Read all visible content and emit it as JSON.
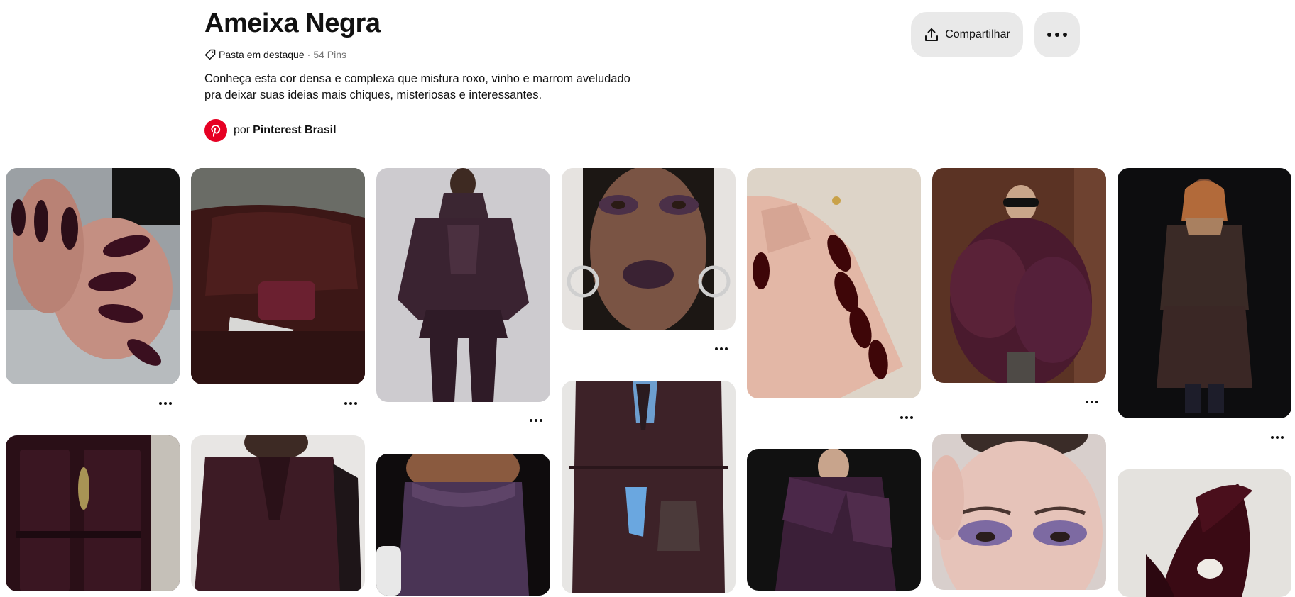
{
  "board": {
    "title": "Ameixa Negra",
    "featured_label": "Pasta em destaque",
    "separator": "·",
    "pin_count": "54 Pins",
    "description_line1": "Conheça esta cor densa e complexa que mistura roxo, vinho e marrom aveludado",
    "description_line2": "pra deixar suas ideias mais chiques, misteriosas e interessantes.",
    "author_prefix": "por",
    "author_name": "Pinterest Brasil"
  },
  "actions": {
    "share_label": "Compartilhar",
    "share_icon": "share-icon",
    "more_icon": "ellipsis-icon"
  },
  "pins": [
    {
      "subject": "Dark plum almond nails"
    },
    {
      "subject": "Burgundy leather sofa with handbag and magazine"
    },
    {
      "subject": "Dark plum leather jacket outfit"
    },
    {
      "subject": "Plum smoky eye makeup with glossy lips"
    },
    {
      "subject": "Burgundy nails on hand"
    },
    {
      "subject": "Plum fur coat with sunglasses"
    },
    {
      "subject": "Dark leather coat and skirt look"
    },
    {
      "subject": "Dark plum front door with brass knocker"
    },
    {
      "subject": "Burgundy wool coat"
    },
    {
      "subject": "Purple silk camisole top"
    },
    {
      "subject": "Plum blazer with blue glove and bag"
    },
    {
      "subject": "Plum off-shoulder satin dress"
    },
    {
      "subject": "Purple shimmer eyeshadow makeup"
    },
    {
      "subject": "Dark anthurium flower arrangement"
    }
  ],
  "colors": {
    "pinterest_red": "#e60023",
    "button_bg": "#e9e9e9",
    "plum": "#3a1f2c"
  }
}
